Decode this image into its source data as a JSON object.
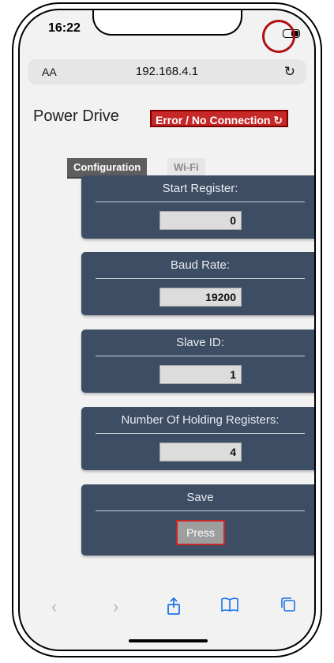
{
  "status_bar": {
    "time": "16:22"
  },
  "address_bar": {
    "text_size_label": "AA",
    "url": "192.168.4.1",
    "reload_icon": "reload-icon"
  },
  "header": {
    "title": "Power Drive",
    "connection_status": "Error / No Connection ↻"
  },
  "tabs": [
    {
      "label": "Configuration",
      "active": true
    },
    {
      "label": "Wi-Fi",
      "active": false
    }
  ],
  "fields": {
    "start_register": {
      "label": "Start Register:",
      "value": "0"
    },
    "baud_rate": {
      "label": "Baud Rate:",
      "value": "19200"
    },
    "slave_id": {
      "label": "Slave ID:",
      "value": "1"
    },
    "holding_registers": {
      "label": "Number Of Holding Registers:",
      "value": "4"
    }
  },
  "save": {
    "label": "Save",
    "button_label": "Press"
  },
  "toolbar": {
    "back": "back-arrow-icon",
    "forward": "forward-arrow-icon",
    "share": "share-icon",
    "bookmarks": "bookmarks-icon",
    "tabs": "tabs-icon"
  },
  "colors": {
    "card_background": "#3d4d63",
    "error_red": "#c62828",
    "tab_active": "#5e5e5e",
    "toolbar_blue": "#1a73e8"
  }
}
